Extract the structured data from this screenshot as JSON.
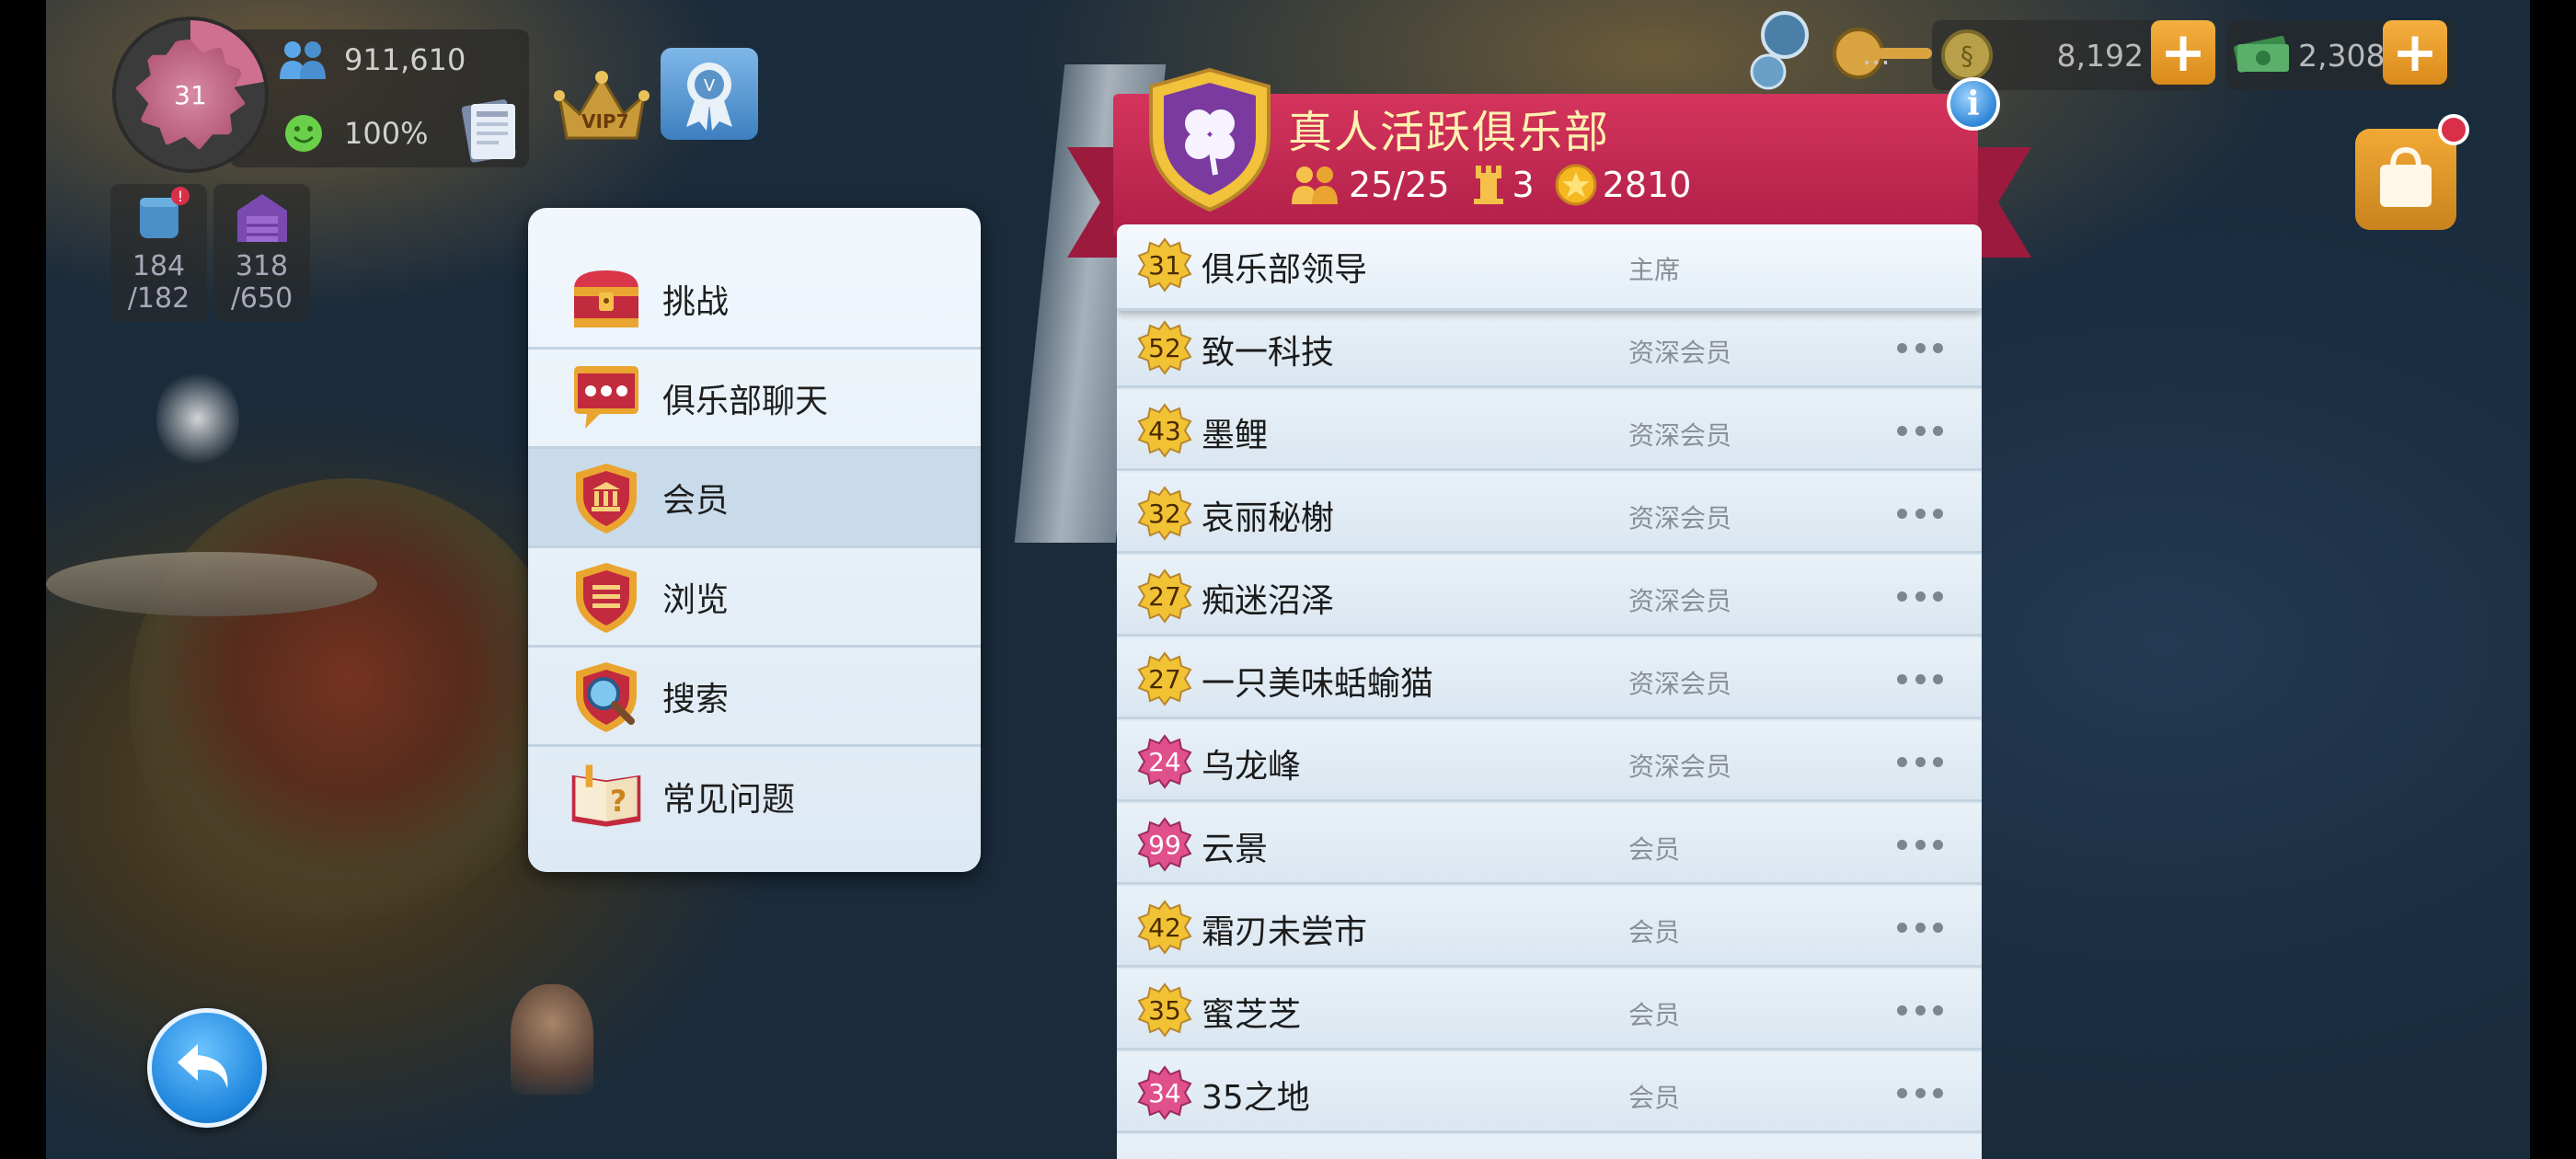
{
  "hud": {
    "level": "31",
    "population": "911,610",
    "happiness": "100%",
    "vip_label": "VIP7",
    "storage_left": {
      "value": "184",
      "max": "/182"
    },
    "storage_right": {
      "value": "318",
      "max": "/650"
    },
    "simoleons": "8,192",
    "simcash": "2,308",
    "more_dots": "..."
  },
  "menu": {
    "items": [
      {
        "label": "挑战",
        "icon": "treasure-chest-icon"
      },
      {
        "label": "俱乐部聊天",
        "icon": "chat-bubble-icon"
      },
      {
        "label": "会员",
        "icon": "members-shield-icon",
        "active": true
      },
      {
        "label": "浏览",
        "icon": "browse-shield-icon"
      },
      {
        "label": "搜索",
        "icon": "magnifier-icon"
      },
      {
        "label": "常见问题",
        "icon": "faq-book-icon"
      }
    ]
  },
  "club": {
    "name": "真人活跃俱乐部",
    "members": "25/25",
    "wars": "3",
    "points": "2810",
    "info": "i"
  },
  "members": [
    {
      "level": "31",
      "name": "俱乐部领导",
      "role": "主席",
      "badge": "gold",
      "leader": true
    },
    {
      "level": "52",
      "name": "致一科技",
      "role": "资深会员",
      "badge": "gold"
    },
    {
      "level": "43",
      "name": "墨鲤",
      "role": "资深会员",
      "badge": "gold"
    },
    {
      "level": "32",
      "name": "哀丽秘榭",
      "role": "资深会员",
      "badge": "gold"
    },
    {
      "level": "27",
      "name": "痴迷沼泽",
      "role": "资深会员",
      "badge": "gold"
    },
    {
      "level": "27",
      "name": "一只美味蛞蝓猫",
      "role": "资深会员",
      "badge": "gold"
    },
    {
      "level": "24",
      "name": "乌龙峰",
      "role": "资深会员",
      "badge": "pink"
    },
    {
      "level": "99",
      "name": "云景",
      "role": "会员",
      "badge": "pink"
    },
    {
      "level": "42",
      "name": "霜刃未尝市",
      "role": "会员",
      "badge": "gold"
    },
    {
      "level": "35",
      "name": "蜜芝芝",
      "role": "会员",
      "badge": "gold"
    },
    {
      "level": "34",
      "name": "35之地",
      "role": "会员",
      "badge": "pink"
    }
  ],
  "colors": {
    "banner": "#c22a52",
    "club_name": "#fff2b0",
    "badge_gold": "#f2c235",
    "badge_pink": "#e0508a",
    "accent_orange": "#e89a2a"
  }
}
